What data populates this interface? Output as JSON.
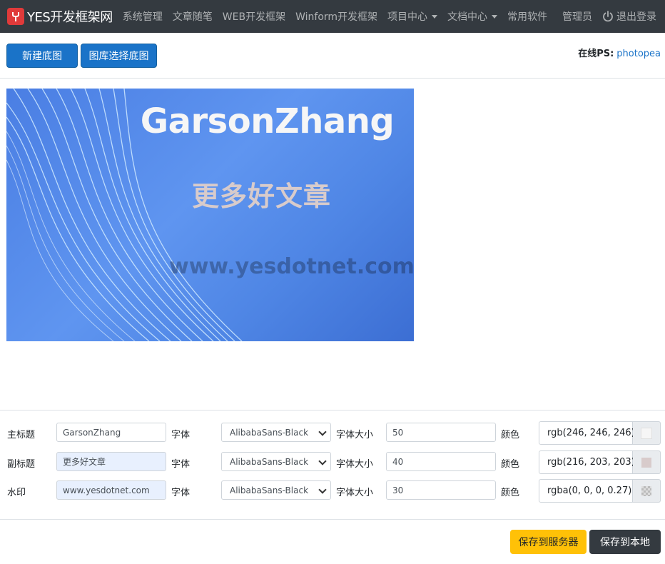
{
  "navbar": {
    "brand": "YES开发框架网",
    "items": [
      {
        "label": "系统管理",
        "dropdown": false
      },
      {
        "label": "文章随笔",
        "dropdown": false
      },
      {
        "label": "WEB开发框架",
        "dropdown": false
      },
      {
        "label": "Winform开发框架",
        "dropdown": false
      },
      {
        "label": "项目中心",
        "dropdown": true
      },
      {
        "label": "文档中心",
        "dropdown": true
      },
      {
        "label": "常用软件",
        "dropdown": false
      }
    ],
    "user": "管理员",
    "logout": "退出登录"
  },
  "toolbar": {
    "new_bg_label": "新建底图",
    "choose_bg_label": "图库选择底图",
    "online_ps_label": "在线PS:",
    "online_ps_link": "photopea"
  },
  "banner": {
    "title": "GarsonZhang",
    "subtitle": "更多好文章",
    "watermark": "www.yesdotnet.com",
    "title_color": "#f6f6f6",
    "subtitle_color": "#d8cbcb",
    "watermark_color": "rgba(0,0,0,0.27)"
  },
  "form": {
    "font_label": "字体",
    "size_label": "字体大小",
    "color_label": "颜色",
    "rows": [
      {
        "label": "主标题",
        "value": "GarsonZhang",
        "font": "AlibabaSans-Black",
        "size": "50",
        "color": "rgb(246, 246, 246)",
        "swatch": "#f6f6f6"
      },
      {
        "label": "副标题",
        "value": "更多好文章",
        "font": "AlibabaSans-Black",
        "size": "40",
        "color": "rgb(216, 203, 203)",
        "swatch": "#d8cbcb"
      },
      {
        "label": "水印",
        "value": "www.yesdotnet.com",
        "font": "AlibabaSans-Black",
        "size": "30",
        "color": "rgba(0, 0, 0, 0.27)",
        "swatch": "rgba(0,0,0,0.27)"
      }
    ]
  },
  "footer": {
    "save_server_label": "保存到服务器",
    "save_local_label": "保存到本地"
  }
}
